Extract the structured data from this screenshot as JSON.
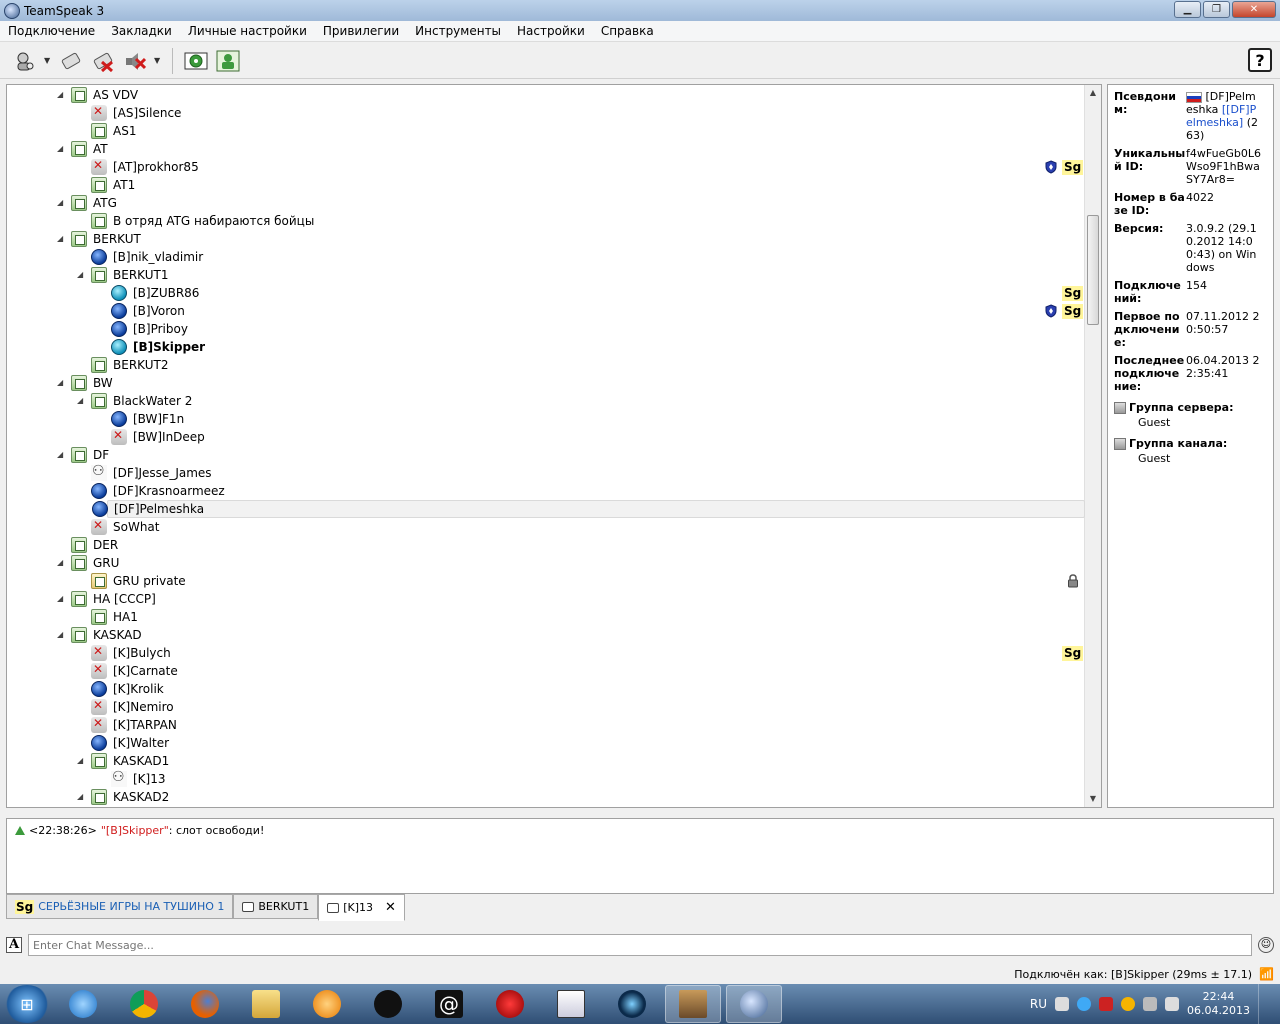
{
  "window": {
    "title": "TeamSpeak 3"
  },
  "menu": [
    "Подключение",
    "Закладки",
    "Личные настройки",
    "Привилегии",
    "Инструменты",
    "Настройки",
    "Справка"
  ],
  "tree": [
    {
      "type": "channel",
      "level": 1,
      "label": "AS VDV",
      "expanded": true
    },
    {
      "type": "user",
      "status": "mute",
      "level": 2,
      "label": "[AS]Silence"
    },
    {
      "type": "channel",
      "level": 2,
      "label": "AS1"
    },
    {
      "type": "channel",
      "level": 1,
      "label": "AT",
      "expanded": true
    },
    {
      "type": "user",
      "status": "mute",
      "level": 2,
      "label": "[AT]prokhor85",
      "badges": [
        "shield",
        "sg"
      ]
    },
    {
      "type": "channel",
      "level": 2,
      "label": "AT1"
    },
    {
      "type": "channel",
      "level": 1,
      "label": "ATG",
      "expanded": true
    },
    {
      "type": "channel",
      "level": 2,
      "label": "В отряд ATG набираются бойцы"
    },
    {
      "type": "channel",
      "level": 1,
      "label": "BERKUT",
      "expanded": true
    },
    {
      "type": "user",
      "status": "blue",
      "level": 2,
      "label": "[B]nik_vladimir"
    },
    {
      "type": "channel",
      "level": 2,
      "label": "BERKUT1",
      "expanded": true
    },
    {
      "type": "user",
      "status": "talk",
      "level": 3,
      "label": "[B]ZUBR86",
      "badges": [
        "sg"
      ]
    },
    {
      "type": "user",
      "status": "blue",
      "level": 3,
      "label": "[B]Voron",
      "badges": [
        "shield",
        "sg"
      ]
    },
    {
      "type": "user",
      "status": "blue",
      "level": 3,
      "label": "[B]Priboy"
    },
    {
      "type": "user",
      "status": "talk",
      "level": 3,
      "label": "[B]Skipper",
      "bold": true
    },
    {
      "type": "channel",
      "level": 2,
      "label": "BERKUT2"
    },
    {
      "type": "channel",
      "level": 1,
      "label": "BW",
      "expanded": true
    },
    {
      "type": "channel",
      "level": 2,
      "label": "BlackWater 2",
      "expanded": true
    },
    {
      "type": "user",
      "status": "blue",
      "level": 3,
      "label": "[BW]F1n"
    },
    {
      "type": "user",
      "status": "mute",
      "level": 3,
      "label": "[BW]InDeep"
    },
    {
      "type": "channel",
      "level": 1,
      "label": "DF",
      "expanded": true
    },
    {
      "type": "user",
      "status": "away",
      "level": 2,
      "label": "[DF]Jesse_James"
    },
    {
      "type": "user",
      "status": "blue",
      "level": 2,
      "label": "[DF]Krasnoarmeez"
    },
    {
      "type": "user",
      "status": "blue",
      "level": 2,
      "label": "[DF]Pelmeshka",
      "selected": true
    },
    {
      "type": "user",
      "status": "mute",
      "level": 2,
      "label": "SoWhat"
    },
    {
      "type": "channel",
      "level": 1,
      "label": "DER"
    },
    {
      "type": "channel",
      "level": 1,
      "label": "GRU",
      "expanded": true
    },
    {
      "type": "channel",
      "private": true,
      "level": 2,
      "label": "GRU private",
      "badges": [
        "lock"
      ]
    },
    {
      "type": "channel",
      "level": 1,
      "label": "HA [CCCP]",
      "expanded": true
    },
    {
      "type": "channel",
      "level": 2,
      "label": "HA1"
    },
    {
      "type": "channel",
      "level": 1,
      "label": "KASKAD",
      "expanded": true
    },
    {
      "type": "user",
      "status": "mute",
      "level": 2,
      "label": "[K]Bulych",
      "badges": [
        "sg"
      ]
    },
    {
      "type": "user",
      "status": "mute",
      "level": 2,
      "label": "[K]Carnate"
    },
    {
      "type": "user",
      "status": "blue",
      "level": 2,
      "label": "[K]Krolik"
    },
    {
      "type": "user",
      "status": "mute",
      "level": 2,
      "label": "[K]Nemiro"
    },
    {
      "type": "user",
      "status": "mute",
      "level": 2,
      "label": "[K]TARPAN"
    },
    {
      "type": "user",
      "status": "blue",
      "level": 2,
      "label": "[K]Walter"
    },
    {
      "type": "channel",
      "level": 2,
      "label": "KASKAD1",
      "expanded": true
    },
    {
      "type": "user",
      "status": "away",
      "level": 3,
      "label": "[K]13"
    },
    {
      "type": "channel",
      "level": 2,
      "label": "KASKAD2",
      "expanded": true
    }
  ],
  "info": {
    "nick_key": "Псевдоним:",
    "nick_val": "[DF]Pelmeshka",
    "nick_link": "[[DF]Pelmeshka]",
    "nick_count": "(263)",
    "uid_key": "Уникальный ID:",
    "uid_val": "f4wFueGb0L6Wso9F1hBwaSY7Ar8=",
    "dbid_key": "Номер в базе ID:",
    "dbid_val": "4022",
    "version_key": "Версия:",
    "version_val": "3.0.9.2 (29.10.2012 14:00:43) on Windows",
    "conn_key": "Подключений:",
    "conn_val": "154",
    "first_key": "Первое подключение:",
    "first_val": "07.11.2012 20:50:57",
    "last_key": "Последнее подключение:",
    "last_val": "06.04.2013 22:35:41",
    "server_group_key": "Группа сервера:",
    "server_group_val": "Guest",
    "channel_group_key": "Группа канала:",
    "channel_group_val": "Guest"
  },
  "chat": {
    "time": "<22:38:26>",
    "nick": "\"[B]Skipper\"",
    "message": ": слот освободи!"
  },
  "tabs": [
    {
      "label": "СЕРЬЁЗНЫЕ ИГРЫ НА ТУШИНО 1",
      "sg": "Sg"
    },
    {
      "label": "BERKUT1"
    },
    {
      "label": "[K]13",
      "close": "✕"
    }
  ],
  "chat_input": {
    "placeholder": "Enter Chat Message..."
  },
  "status": {
    "text": "Подключён как: [B]Skipper (29ms ± 17.1)"
  },
  "taskbar": {
    "lang": "RU",
    "time": "22:44",
    "date": "06.04.2013"
  },
  "badge_sg": "Sg"
}
